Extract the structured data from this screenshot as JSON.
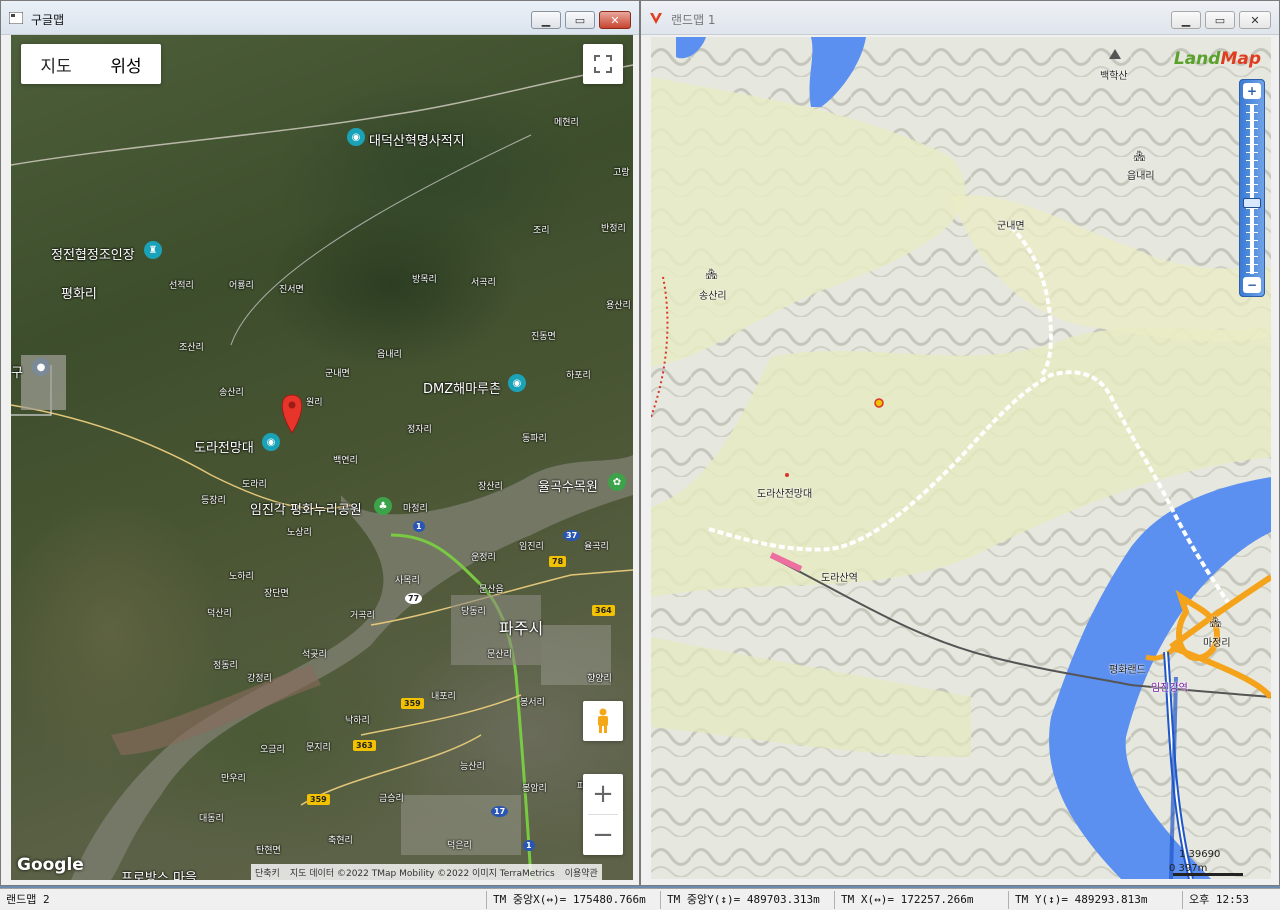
{
  "left_window": {
    "title": "구글맵",
    "map_type": {
      "map": "지도",
      "satellite": "위성"
    },
    "labels": {
      "daedeoksan": "대덕산혁명사적지",
      "jeongjeon": "정전협정조인장",
      "pyeonghwa": "평화리",
      "myeonhyeon": "메현리",
      "goryang": "고랑",
      "banjeong": "반정리",
      "jori": "조리",
      "bangmok": "방목리",
      "seogok": "서곡리",
      "yongsan": "용산리",
      "jinseo": "진서면",
      "eoryong": "어룡리",
      "seonjeok": "선적리",
      "jinsdong": "진동면",
      "josan": "조산리",
      "eumnae": "읍내리",
      "gunnae": "군내면",
      "dmz": "DMZ해마루촌",
      "hapo": "하포리",
      "gu": "구",
      "songsan": "송산리",
      "won": "원리",
      "dorajeon": "도라전망대",
      "jeongja": "정자리",
      "dongpa": "동파리",
      "baegyeon": "백연리",
      "dora": "도라리",
      "janggok": "장산리",
      "yulgok": "율곡수목원",
      "dengjang": "등장리",
      "imjingak": "임진각 평화누리공원",
      "majeong": "마정리",
      "nosang": "노상리",
      "imjin": "임진리",
      "yulgok_ri": "율곡리",
      "unjeong": "운정리",
      "noha": "노하리",
      "sanmok": "사목리",
      "munsan": "문산읍",
      "jangdan": "장단면",
      "deoksan": "덕산리",
      "danggong": "당동리",
      "paju": "파주시",
      "geogok": "거곡리",
      "seokgot": "석곶리",
      "munsan_ri": "문산리",
      "hyangyang": "향양리",
      "jeongdong": "정동리",
      "gangjeong": "강정리",
      "naepo": "내포리",
      "bongseo": "봉서리",
      "nakha": "낙하리",
      "ogeum": "오금리",
      "munji": "문지리",
      "dangsan": "능산리",
      "manu": "만우리",
      "bongam": "봉암리",
      "paju_ri": "파주리",
      "geumseung": "금승리",
      "daedong": "대동리",
      "chukhyeon": "축현리",
      "deogeun": "덕은리",
      "tanhyeon": "탄현면",
      "bottom": "프로방스 마을"
    },
    "shields": {
      "r1": "1",
      "r37": "37",
      "r78": "78",
      "r77": "77",
      "r364": "364",
      "r359a": "359",
      "r363": "363",
      "r359b": "359",
      "r17": "17",
      "r1b": "1"
    },
    "google": "Google",
    "attribution": {
      "shortcuts": "단축키",
      "data": "지도 데이터 ©2022 TMap Mobility ©2022 이미지 TerraMetrics",
      "terms": "이용약관"
    }
  },
  "right_window": {
    "title": "랜드맵 1",
    "logo": {
      "land": "Land",
      "map": "Map"
    },
    "labels": {
      "baekhak": "백학산",
      "eupnae": "읍내리",
      "gunnae": "군내면",
      "songsan": "송산리",
      "dorasan_obs": "도라산전망대",
      "dorasan_sta": "도라산역",
      "majeong": "마정리",
      "pyeonghwaland": "평화랜드",
      "imjingang": "임진강역"
    },
    "scale": {
      "top": "1   39690",
      "bottom": "0   397m"
    }
  },
  "statusbar": {
    "name": "랜드맵 2",
    "tm_center_x": "TM 중앙X(↔)= 175480.766m",
    "tm_center_y": "TM 중앙Y(↕)= 489703.313m",
    "tm_x": "TM X(↔)= 172257.266m",
    "tm_y": "TM Y(↕)= 489293.813m",
    "clock": "오후 12:53"
  },
  "colors": {
    "river": "#5b8ff0",
    "expressway": "#f5a31a",
    "road_green": "#7ac943",
    "marker": "#e8352b"
  }
}
